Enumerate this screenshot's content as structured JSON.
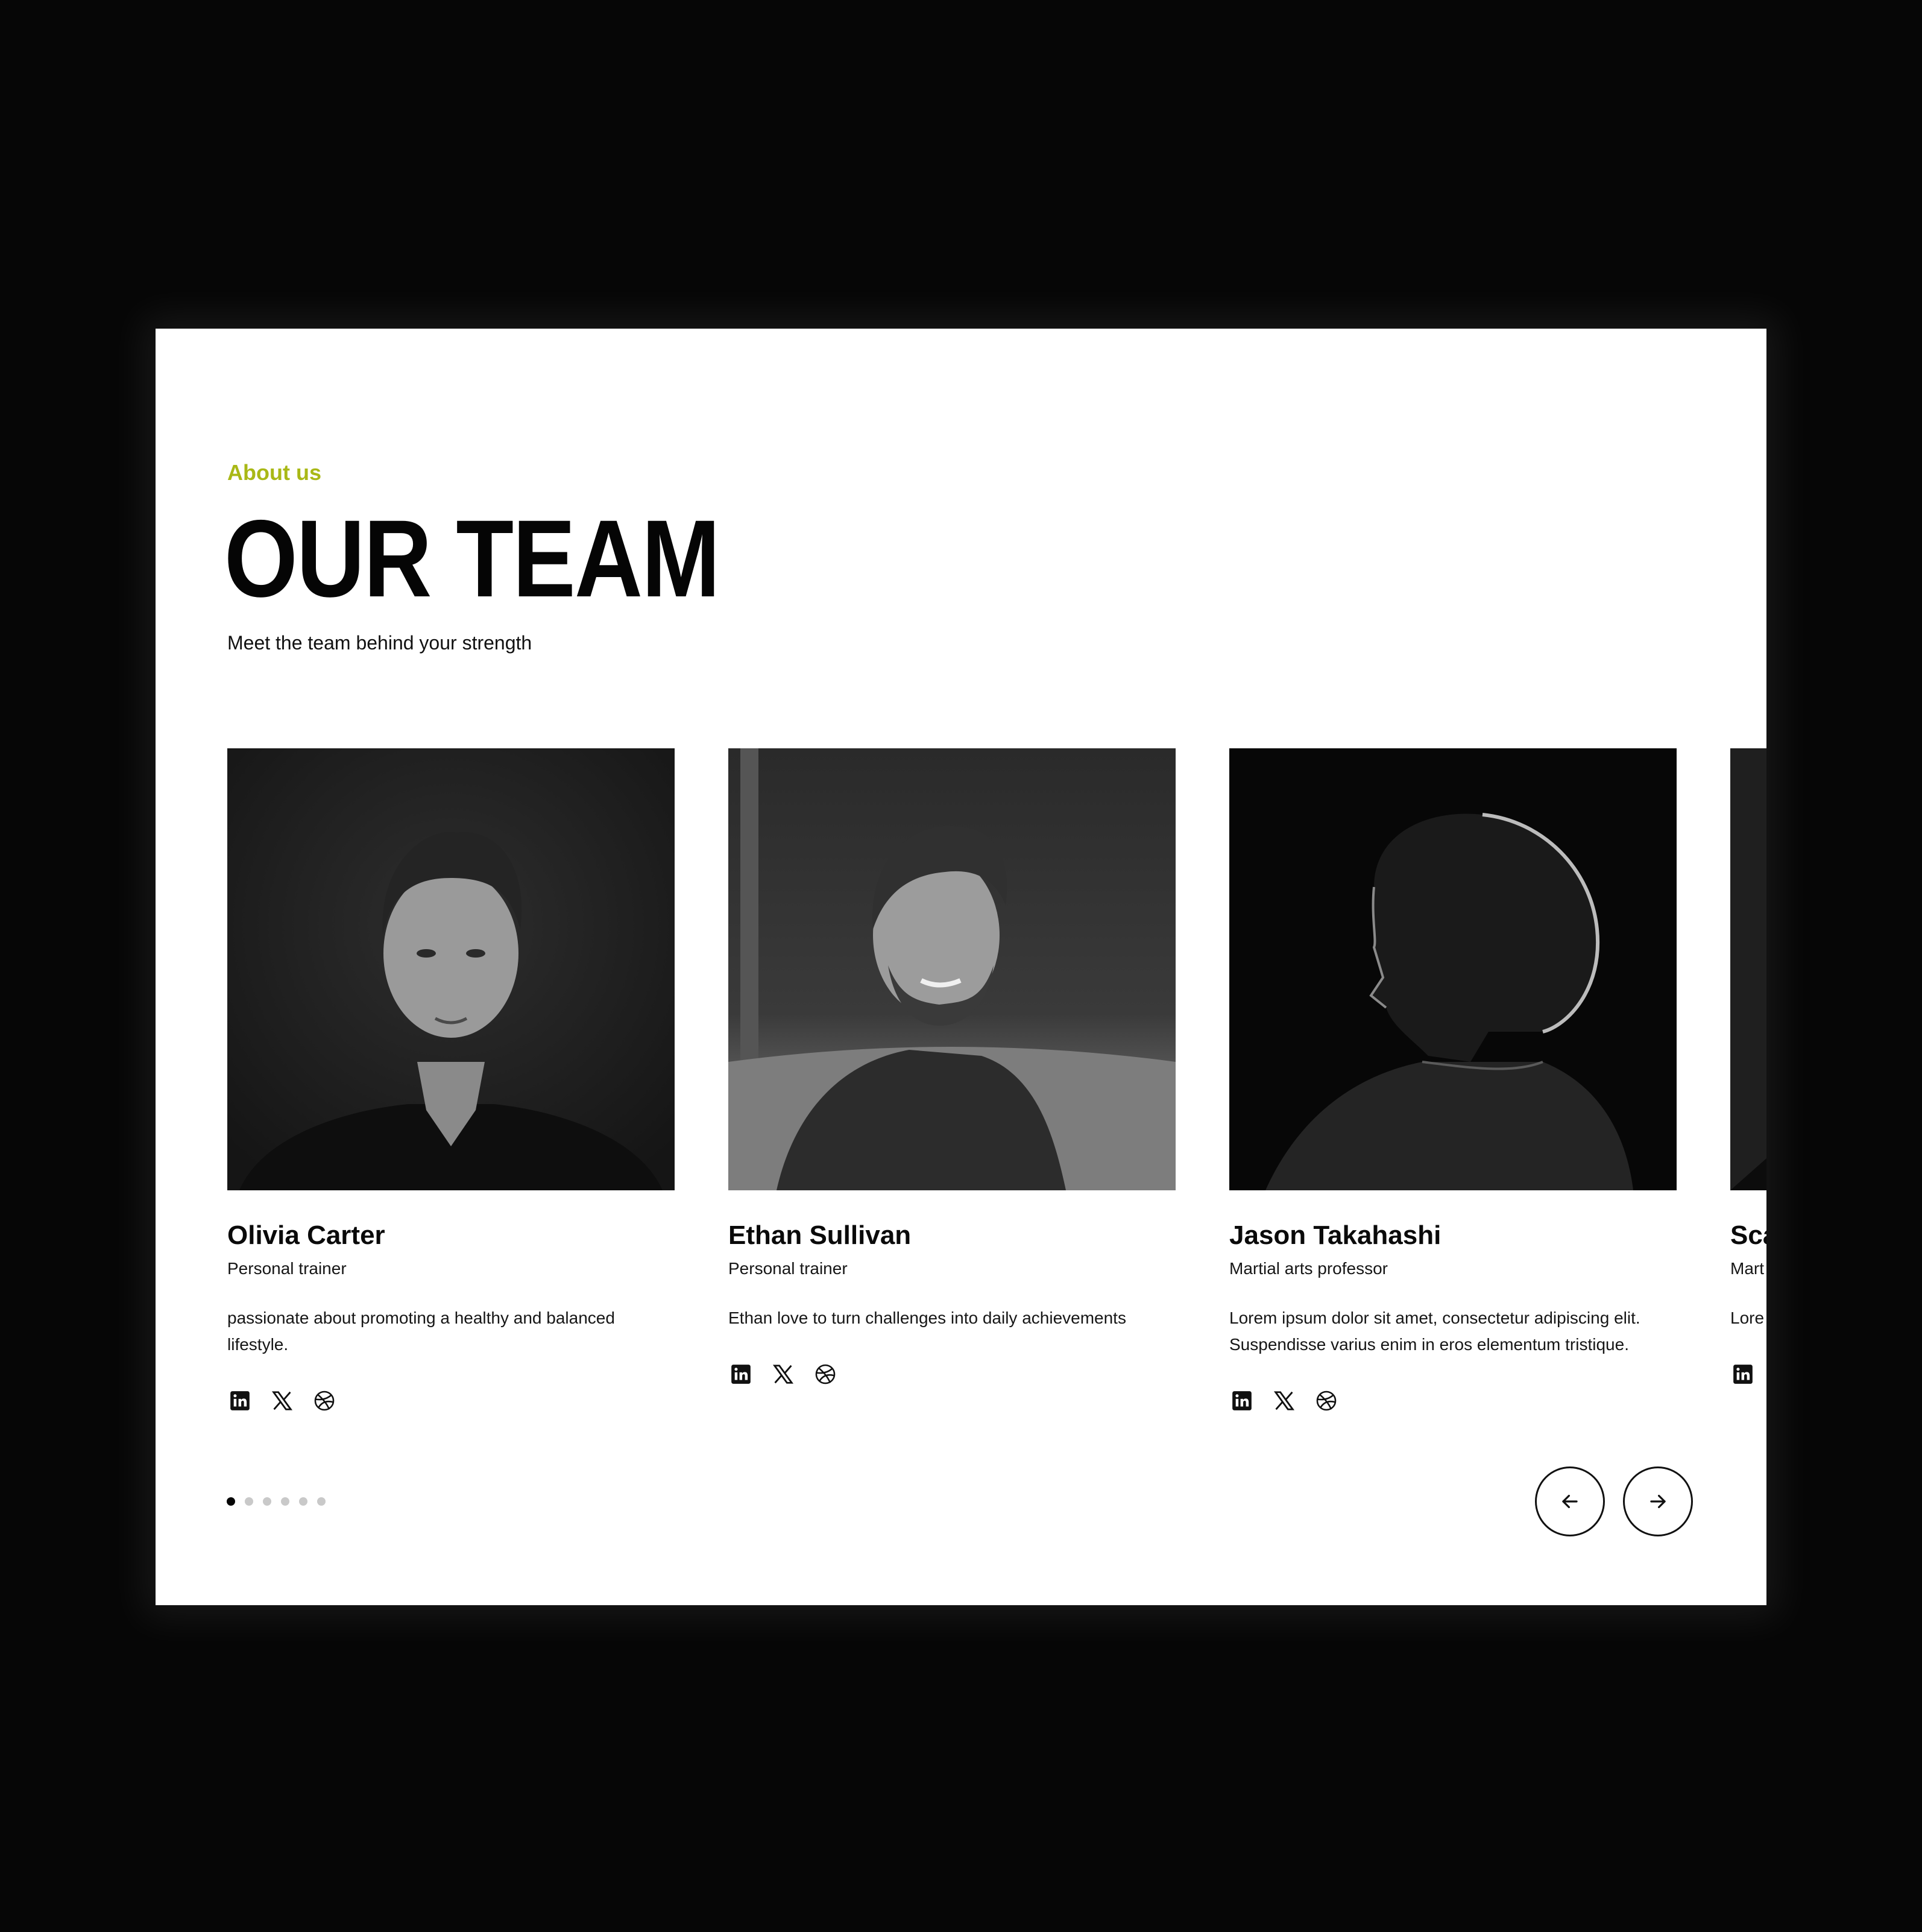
{
  "header": {
    "eyebrow": "About us",
    "title": "OUR TEAM",
    "subtitle": "Meet the team behind your strength"
  },
  "team": [
    {
      "name": "Olivia Carter",
      "role": "Personal trainer",
      "bio": "passionate about promoting a healthy and balanced lifestyle.",
      "socials": [
        "linkedin-icon",
        "x-icon",
        "dribbble-icon"
      ]
    },
    {
      "name": "Ethan Sullivan",
      "role": "Personal trainer",
      "bio": "Ethan love to turn challenges into daily achievements",
      "socials": [
        "linkedin-icon",
        "x-icon",
        "dribbble-icon"
      ]
    },
    {
      "name": "Jason Takahashi",
      "role": "Martial arts professor",
      "bio": "Lorem ipsum dolor sit amet, consectetur adipiscing elit. Suspendisse varius enim in eros elementum tristique.",
      "socials": [
        "linkedin-icon",
        "x-icon",
        "dribbble-icon"
      ]
    },
    {
      "name": "Sca",
      "role": "Mart",
      "bio": "Lore Susp",
      "socials": [
        "linkedin-icon"
      ]
    }
  ],
  "pagination": {
    "total": 6,
    "active": 0
  },
  "nav": {
    "prev_icon": "arrow-left-icon",
    "next_icon": "arrow-right-icon"
  },
  "colors": {
    "accent": "#a9b816",
    "text": "#050505",
    "background": "#ffffff",
    "backdrop": "#060606"
  }
}
